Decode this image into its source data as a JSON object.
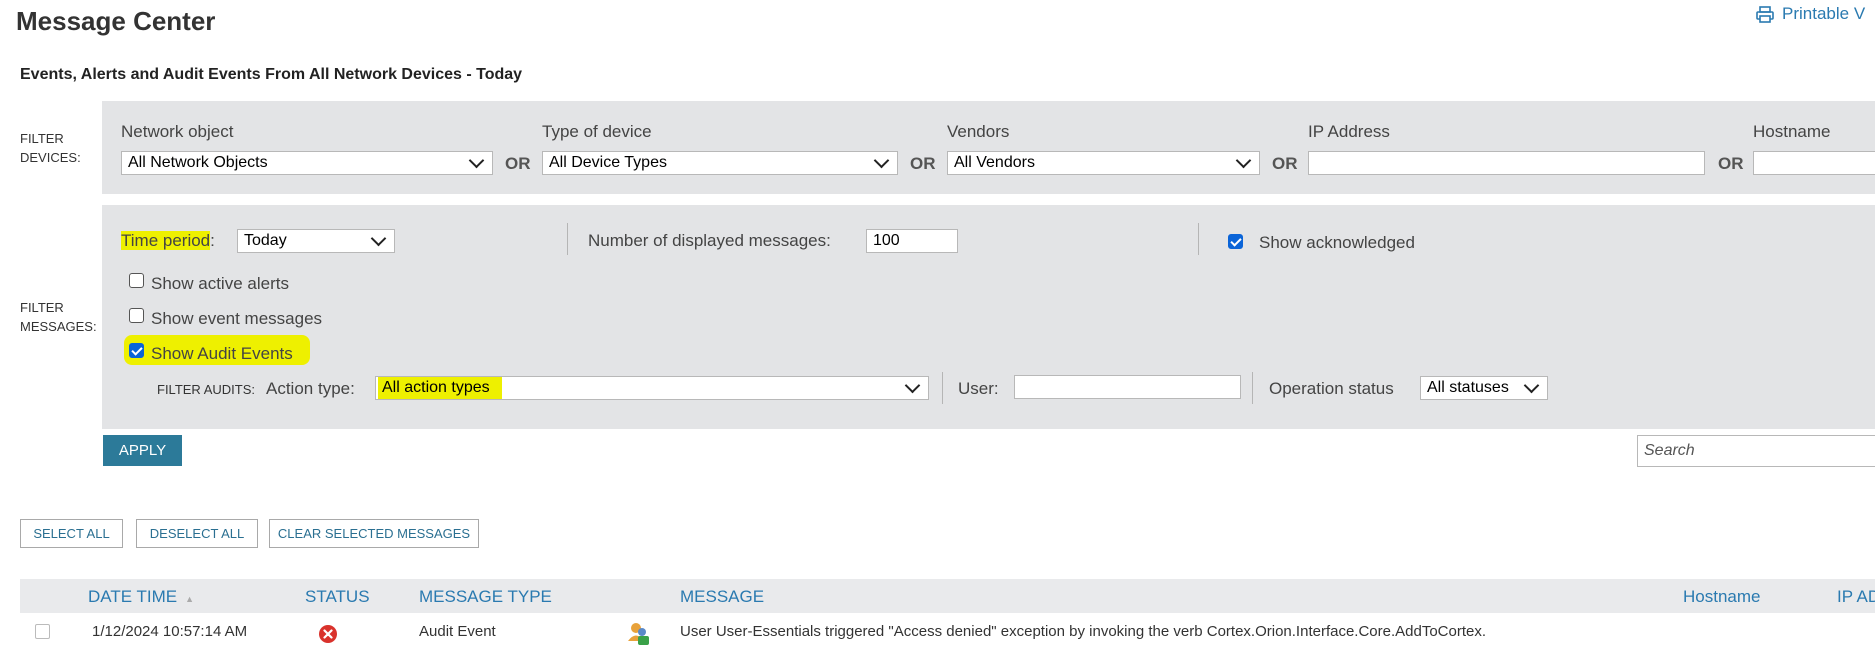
{
  "page": {
    "title": "Message Center",
    "printable_label": "Printable V",
    "subtitle": "Events, Alerts and Audit Events From All Network Devices - Today"
  },
  "filter_devices": {
    "side_label_1": "FILTER",
    "side_label_2": "DEVICES:",
    "network_object": {
      "label": "Network object",
      "value": "All Network Objects"
    },
    "device_type": {
      "label": "Type of device",
      "value": "All Device Types"
    },
    "vendors": {
      "label": "Vendors",
      "value": "All Vendors"
    },
    "ip_address": {
      "label": "IP Address",
      "value": ""
    },
    "hostname": {
      "label": "Hostname",
      "value": ""
    },
    "or_label": "OR"
  },
  "filter_messages": {
    "side_label_1": "FILTER",
    "side_label_2": "MESSAGES:",
    "time_period_label": "Time period",
    "time_period_colon": ":",
    "time_period_value": "Today",
    "num_messages_label": "Number of displayed messages:",
    "num_messages_value": "100",
    "show_acknowledged": {
      "label": "Show acknowledged",
      "checked": true
    },
    "show_active_alerts": {
      "label": "Show active alerts",
      "checked": false
    },
    "show_event_messages": {
      "label": "Show event messages",
      "checked": false
    },
    "show_audit_events": {
      "label": "Show Audit Events",
      "checked": true
    },
    "filter_audits_label": "FILTER AUDITS:",
    "action_type_label": "Action type:",
    "action_type_value": "All action types",
    "user_label": "User:",
    "user_value": "",
    "operation_status_label": "Operation status",
    "operation_status_value": "All statuses"
  },
  "apply_label": "APPLY",
  "search_placeholder": "Search",
  "actions": {
    "select_all": "SELECT ALL",
    "deselect_all": "DESELECT ALL",
    "clear_selected": "CLEAR SELECTED MESSAGES"
  },
  "table": {
    "columns": {
      "date_time": "DATE TIME",
      "status": "STATUS",
      "message_type": "MESSAGE TYPE",
      "message": "MESSAGE",
      "hostname": "Hostname",
      "ip": "IP AD"
    },
    "rows": [
      {
        "date_time": "1/12/2024 10:57:14 AM",
        "status_icon": "error-icon",
        "message_type": "Audit Event",
        "type_icon": "user-audit-icon",
        "message": "User User-Essentials triggered \"Access denied\" exception by invoking the verb Cortex.Orion.Interface.Core.AddToCortex."
      }
    ]
  },
  "colors": {
    "accent": "#2a7ab0",
    "apply_bg": "#2c7a99",
    "panel_bg": "#e3e4e6",
    "highlight": "#eef000",
    "error": "#d9322c"
  }
}
